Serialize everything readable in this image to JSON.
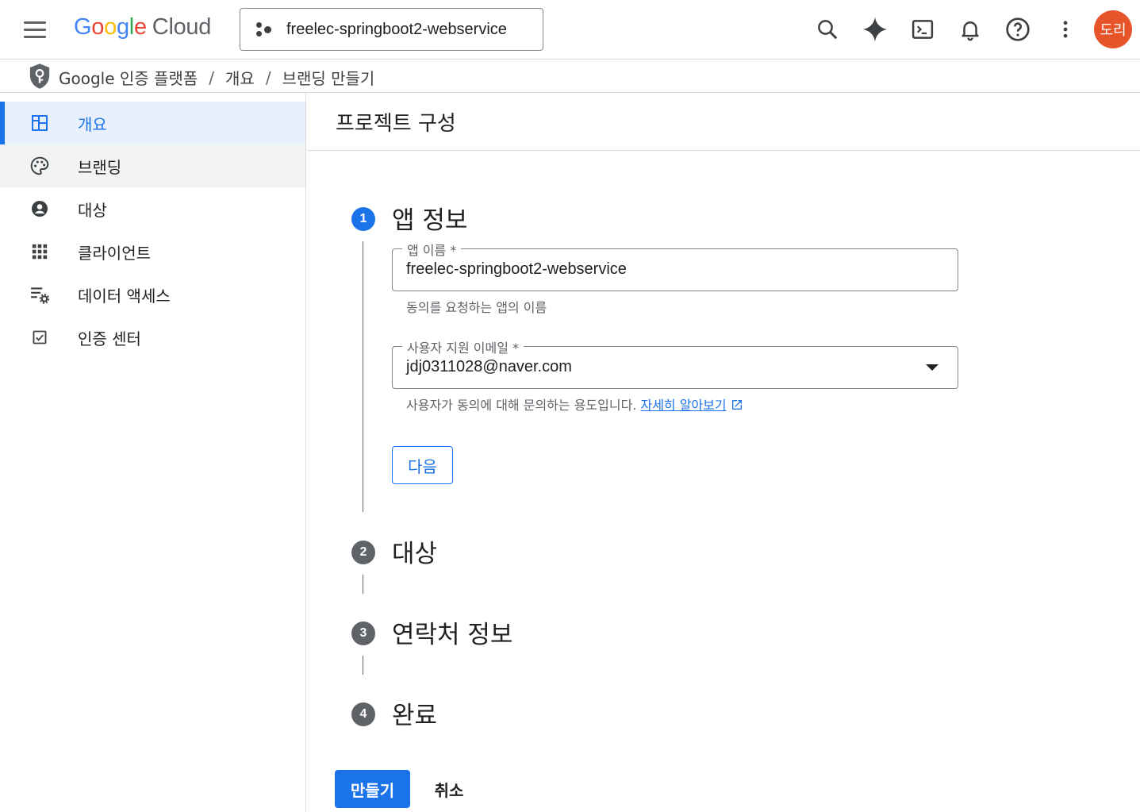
{
  "topbar": {
    "logo_google": [
      "G",
      "o",
      "o",
      "g",
      "l",
      "e"
    ],
    "logo_cloud": "Cloud",
    "project_name": "freelec-springboot2-webservice",
    "avatar_text": "도리",
    "icons": [
      "menu-icon",
      "search-icon",
      "gemini-sparkle-icon",
      "cloud-shell-icon",
      "notifications-bell-icon",
      "help-icon",
      "more-vert-icon"
    ]
  },
  "breadcrumb": {
    "items": [
      "Google 인증 플랫폼",
      "개요",
      "브랜딩 만들기"
    ],
    "separator": "/"
  },
  "sidebar": {
    "items": [
      {
        "label": "개요",
        "icon": "dashboard-icon",
        "state": "active"
      },
      {
        "label": "브랜딩",
        "icon": "palette-icon",
        "state": "hover"
      },
      {
        "label": "대상",
        "icon": "account-circle-icon",
        "state": ""
      },
      {
        "label": "클라이언트",
        "icon": "apps-grid-icon",
        "state": ""
      },
      {
        "label": "데이터 액세스",
        "icon": "data-settings-icon",
        "state": ""
      },
      {
        "label": "인증 센터",
        "icon": "checkbox-icon",
        "state": ""
      }
    ]
  },
  "main": {
    "title": "프로젝트 구성",
    "steps": [
      {
        "num": "1",
        "title": "앱 정보"
      },
      {
        "num": "2",
        "title": "대상"
      },
      {
        "num": "3",
        "title": "연락처 정보"
      },
      {
        "num": "4",
        "title": "완료"
      }
    ],
    "app_name": {
      "label": "앱 이름 *",
      "value": "freelec-springboot2-webservice",
      "helper": "동의를 요청하는 앱의 이름"
    },
    "support_email": {
      "label": "사용자 지원 이메일 *",
      "value": "jdj0311028@naver.com",
      "helper": "사용자가 동의에 대해 문의하는 용도입니다.",
      "helper_link": "자세히 알아보기"
    },
    "next_button": "다음",
    "create_button": "만들기",
    "cancel_button": "취소"
  },
  "colors": {
    "accent": "#1a73e8",
    "avatar": "#e8542a",
    "active_nav_bg": "#e8f0fe"
  }
}
